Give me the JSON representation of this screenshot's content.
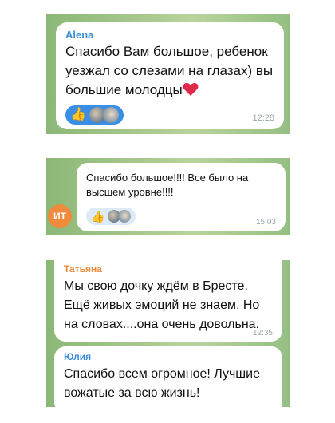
{
  "msg1": {
    "sender": "Alena",
    "sender_color": "#3d8ed8",
    "text": "Спасибо Вам большое, ребенок уезжал со слезами на глазах) вы большие молодцы",
    "heart_icon": "red-heart",
    "reactions": [
      "thumbs-up",
      "avatar-1",
      "avatar-2"
    ],
    "time": "12:28"
  },
  "msg2": {
    "text": "Спасибо большое!!!! Все было на высшем уровне!!!!",
    "avatar_initials": "ИТ",
    "avatar_color": "#f08a3c",
    "reactions": [
      "thumbs-up",
      "avatar-1",
      "avatar-2"
    ],
    "time": "15:03"
  },
  "msg3": {
    "sender": "Татьяна",
    "sender_color": "#e88a3a",
    "text": "Мы свою дочку ждём в Бресте. Ещё живых эмоций не знаем. Но на словах....она очень довольна.",
    "time": "12:35"
  },
  "msg4": {
    "sender": "Юлия",
    "sender_color": "#3d8ed8",
    "text": "Спасибо всем огромное! Лучшие вожатые за всю жизнь!"
  }
}
